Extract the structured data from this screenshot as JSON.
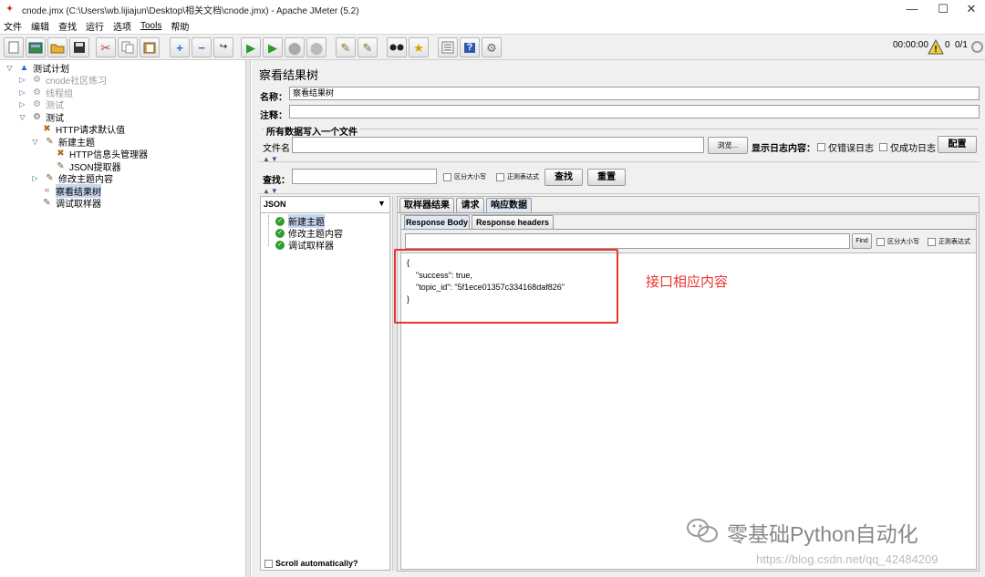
{
  "window": {
    "title": "cnode.jmx (C:\\Users\\wb.lijiajun\\Desktop\\相关文档\\cnode.jmx) - Apache JMeter (5.2)",
    "controls": [
      "—",
      "☐",
      "✕"
    ]
  },
  "menu": [
    "文件",
    "编辑",
    "查找",
    "运行",
    "选项",
    "Tools",
    "帮助"
  ],
  "toolbar": {
    "timer": "00:00:00",
    "warnings": "0",
    "threads": "0/1"
  },
  "tree": {
    "root": "测试计划",
    "items": [
      {
        "label": "cnode社区练习",
        "disabled": true
      },
      {
        "label": "线程组",
        "disabled": true
      },
      {
        "label": "测试",
        "disabled": true
      },
      {
        "label": "测试",
        "disabled": false
      },
      {
        "label": "HTTP请求默认值"
      },
      {
        "label": "新建主题"
      },
      {
        "label": "HTTP信息头管理器"
      },
      {
        "label": "JSON提取器"
      },
      {
        "label": "修改主题内容"
      },
      {
        "label": "察看结果树"
      },
      {
        "label": "调试取样器"
      }
    ]
  },
  "panel": {
    "title": "察看结果树",
    "name_label": "名称：",
    "name_value": "察看结果树",
    "comment_label": "注释：",
    "comment_value": "",
    "file_section_title": "所有数据写入一个文件",
    "filename_label": "文件名",
    "filename_value": "",
    "browse_label": "浏览...",
    "log_label": "显示日志内容：",
    "errors_only": "仅错误日志",
    "success_only": "仅成功日志",
    "configure": "配置"
  },
  "search": {
    "label": "查找：",
    "value": "",
    "case_sensitive": "区分大小写",
    "regex": "正则表达式",
    "find_button": "查找",
    "reset_button": "重置"
  },
  "renderer": {
    "selected": "JSON",
    "results": [
      "新建主题",
      "修改主题内容",
      "调试取样器"
    ],
    "scroll_auto": "Scroll automatically?"
  },
  "tabs": {
    "main": [
      "取样器结果",
      "请求",
      "响应数据"
    ],
    "active_main": "响应数据",
    "sub": [
      "Response Body",
      "Response headers"
    ],
    "active_sub": "Response Body"
  },
  "response": {
    "find_value": "",
    "find_button": "Find",
    "case_sensitive": "区分大小写",
    "regex": "正则表达式",
    "lines": [
      "{",
      "    \"success\": true,",
      "    \"topic_id\": \"5f1ece01357c334168daf826\"",
      "}"
    ],
    "annotation": "接口相应内容",
    "annotation_color": "#e8352e"
  },
  "watermark": {
    "brand": "零基础Python自动化",
    "url": "https://blog.csdn.net/qq_42484209"
  }
}
